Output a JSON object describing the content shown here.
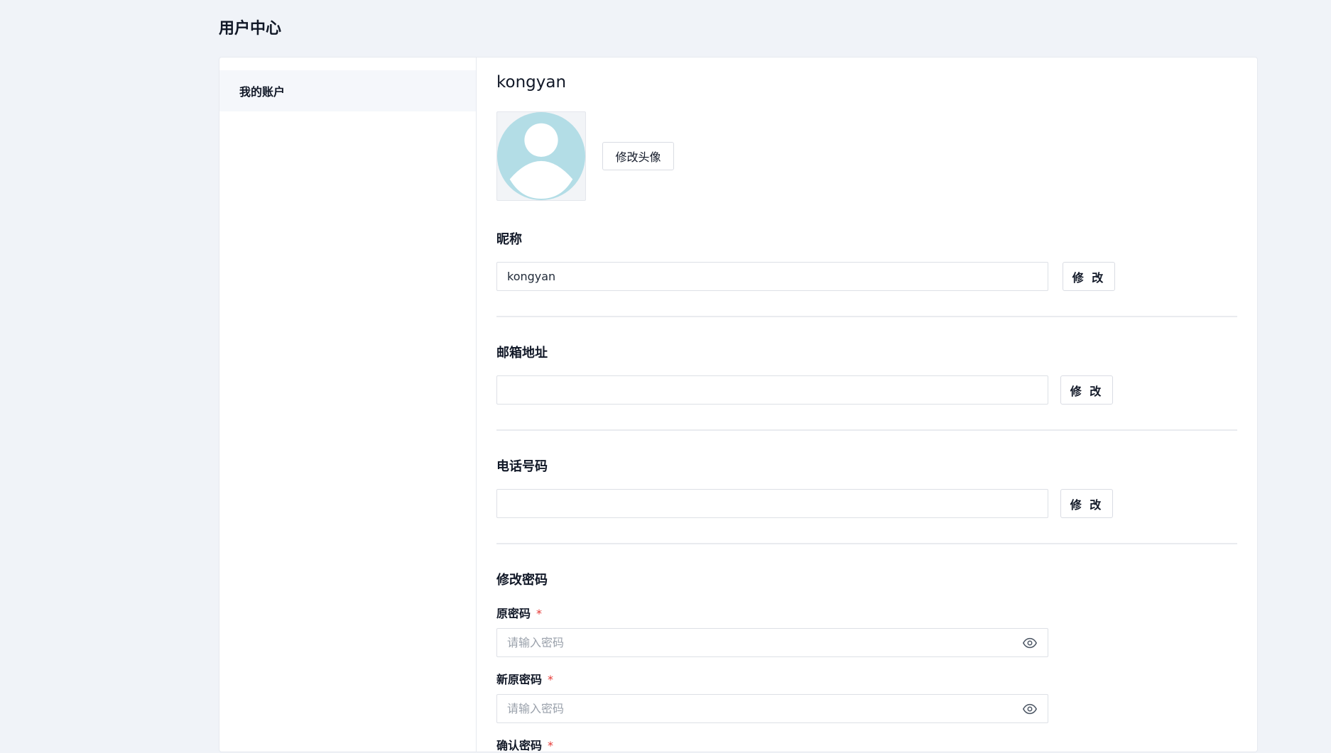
{
  "page": {
    "title": "用户中心"
  },
  "sidebar": {
    "items": [
      {
        "label": "我的账户"
      }
    ]
  },
  "profile": {
    "username": "kongyan",
    "avatar_button": "修改头像"
  },
  "nickname": {
    "label": "昵称",
    "value": "kongyan",
    "button": "修 改"
  },
  "email": {
    "label": "邮箱地址",
    "value": "",
    "button": "修 改"
  },
  "phone": {
    "label": "电话号码",
    "value": "",
    "button": "修 改"
  },
  "password": {
    "label": "修改密码",
    "old": {
      "label": "原密码",
      "required": "*",
      "placeholder": "请输入密码",
      "icon": "eye-icon"
    },
    "new": {
      "label": "新原密码",
      "required": "*",
      "placeholder": "请输入密码",
      "icon": "eye-icon"
    },
    "confirm": {
      "label": "确认密码",
      "required": "*"
    }
  },
  "colors": {
    "background": "#f0f3f8",
    "avatar": "#b3dde6",
    "required": "#e53935"
  }
}
